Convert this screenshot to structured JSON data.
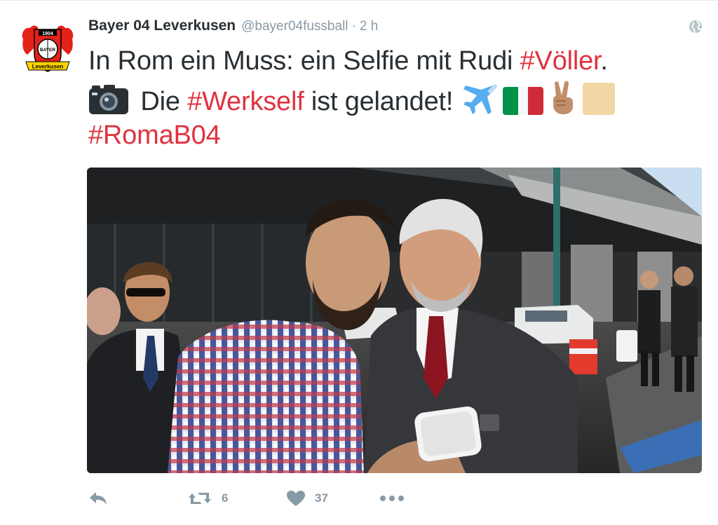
{
  "tweet": {
    "author": {
      "name": "Bayer 04 Leverkusen",
      "handle": "@bayer04fussball",
      "avatar_icon": "bayer04-crest-logo",
      "avatar_text": [
        "1904",
        "BAYER",
        "Leverkusen"
      ]
    },
    "separator": "·",
    "time": "2 h",
    "privacy_icon": "globe-icon",
    "text": {
      "line1_plain": "In Rom ein Muss: ein Selfie mit Rudi ",
      "line1_hashtag": "#Völler",
      "line1_end": ".",
      "line2_emoji": "camera-emoji",
      "line2_plain_a": " Die ",
      "line2_hashtag": "#Werkself",
      "line2_plain_b": " ist gelandet! ",
      "line2_emojis": [
        "airplane-emoji",
        "italy-flag-emoji",
        "victory-hand-emoji",
        "tofu-box-emoji"
      ],
      "line3_hashtag": "#RomaB04"
    },
    "media": {
      "type": "photo",
      "description_icon": "selfie-photo"
    },
    "actions": {
      "reply_icon": "reply-icon",
      "retweet_icon": "retweet-icon",
      "retweet_count": "6",
      "like_icon": "heart-icon",
      "like_count": "37",
      "more_icon": "more-icon"
    },
    "colors": {
      "hashtag": "#e0323f",
      "meta_gray": "#8899a6",
      "text": "#292f33"
    }
  }
}
